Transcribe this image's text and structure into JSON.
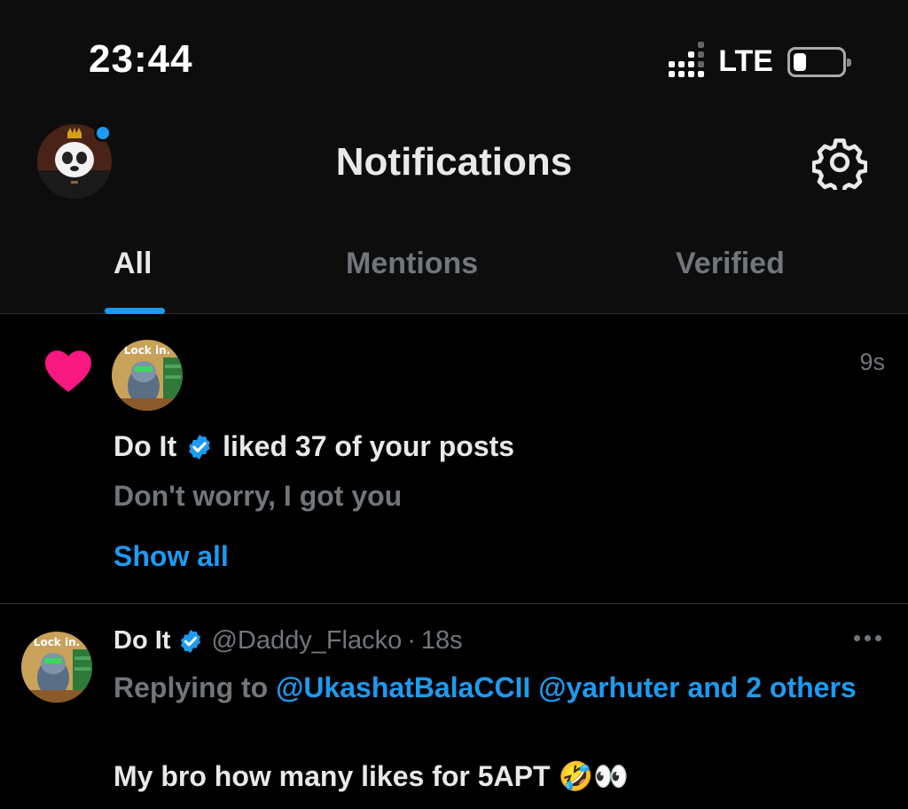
{
  "status_bar": {
    "time": "23:44",
    "network": "LTE"
  },
  "header": {
    "title": "Notifications",
    "has_unread_indicator": true
  },
  "tabs": [
    {
      "label": "All",
      "active": true
    },
    {
      "label": "Mentions",
      "active": false
    },
    {
      "label": "Verified",
      "active": false
    }
  ],
  "notification": {
    "type": "like",
    "icon": "heart-icon",
    "time": "9s",
    "actor_name": "Do It",
    "action_text": "liked 37 of your posts",
    "preview": "Don't worry, I got you",
    "show_all_label": "Show all",
    "avatar_text": "Lock in."
  },
  "post": {
    "author_name": "Do It",
    "handle": "@Daddy_Flacko",
    "dot": "·",
    "time": "18s",
    "replying_prefix": "Replying to",
    "mention_1": "@UkashatBalaCCII",
    "mention_2": "@yarhuter",
    "and_others": "and 2 others",
    "text": "My bro how many likes for 5APT 🤣👀",
    "avatar_text": "Lock in."
  },
  "colors": {
    "accent": "#1d9bf0",
    "like": "#f91880",
    "muted": "#71767b",
    "background": "#000000"
  }
}
